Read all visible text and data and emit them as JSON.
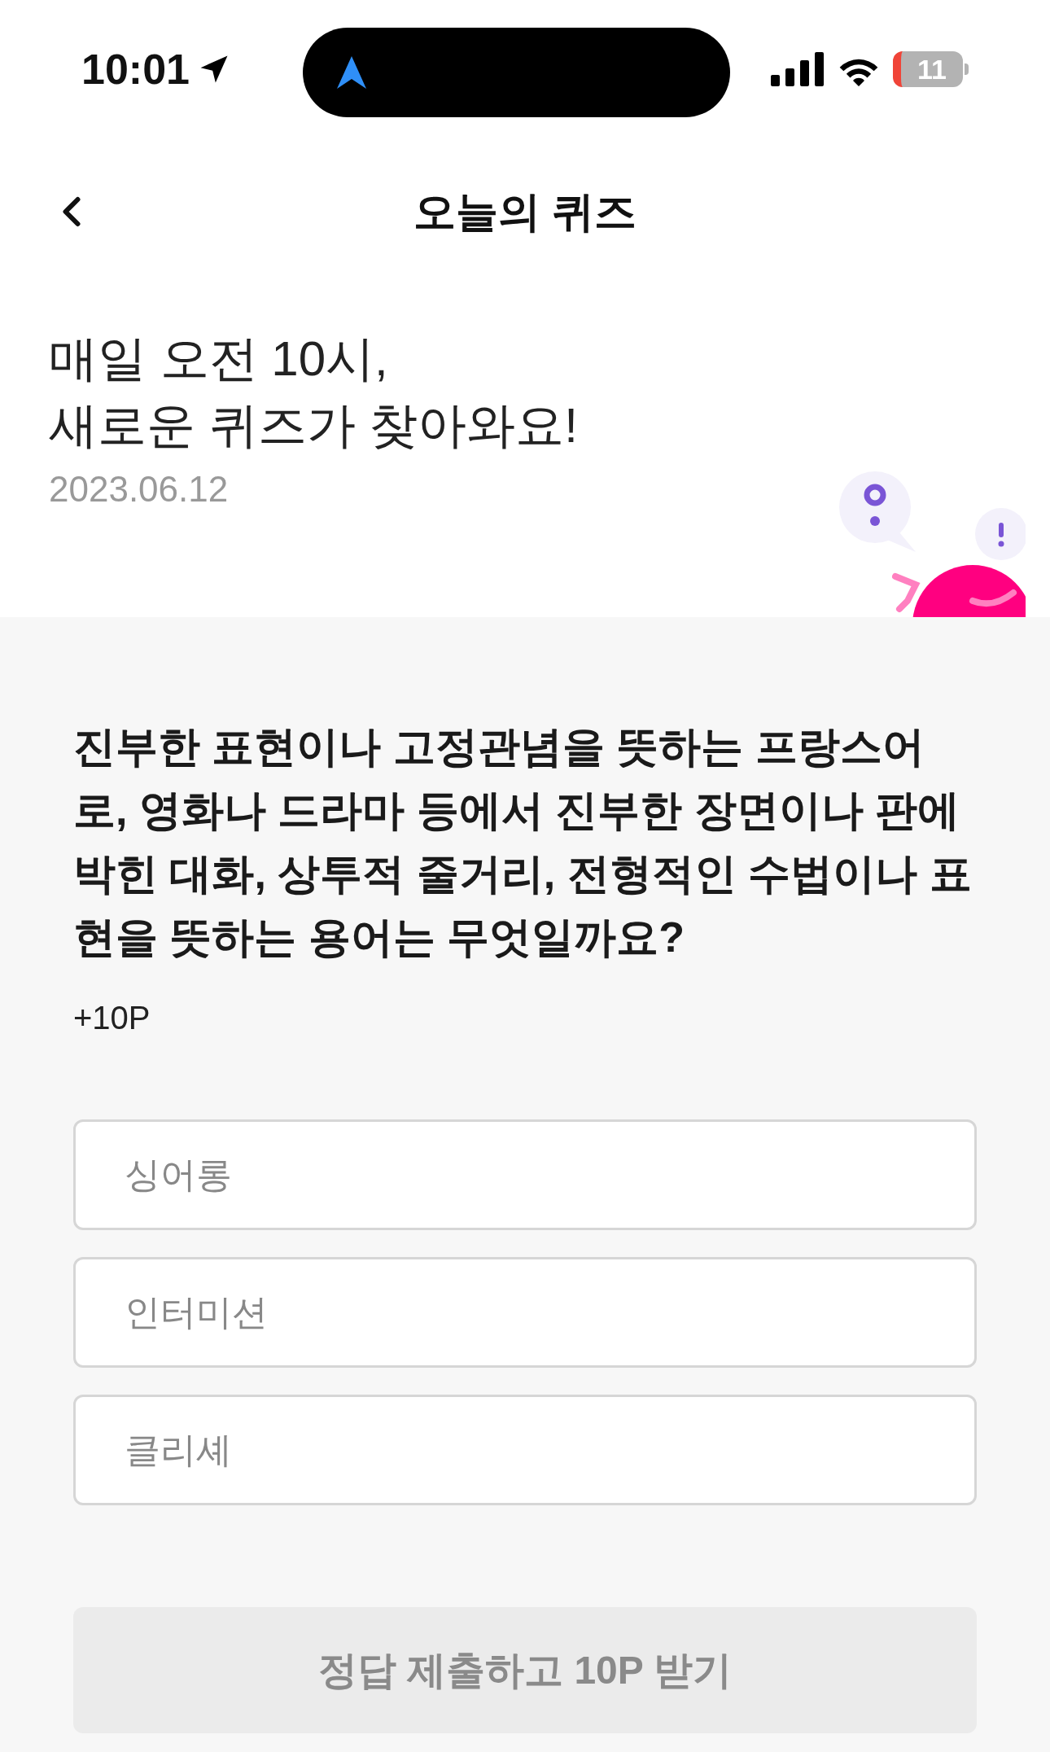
{
  "status_bar": {
    "time": "10:01",
    "battery": "11"
  },
  "header": {
    "title": "오늘의 퀴즈"
  },
  "intro": {
    "lines": [
      "매일 오전 10시,",
      "새로운 퀴즈가 찾아와요!"
    ],
    "date": "2023.06.12"
  },
  "quiz": {
    "question": "진부한 표현이나 고정관념을 뜻하는 프랑스어로, 영화나 드라마 등에서 진부한 장면이나 판에 박힌 대화, 상투적 줄거리, 전형적인 수법이나 표현을 뜻하는 용어는 무엇일까요?",
    "points": "+10P",
    "options": [
      {
        "label": "싱어롱",
        "selected": false
      },
      {
        "label": "인터미션",
        "selected": false
      },
      {
        "label": "클리셰",
        "selected": false
      }
    ]
  },
  "submit": {
    "label": "정답 제출하고 10P 받기",
    "disabled": true
  }
}
